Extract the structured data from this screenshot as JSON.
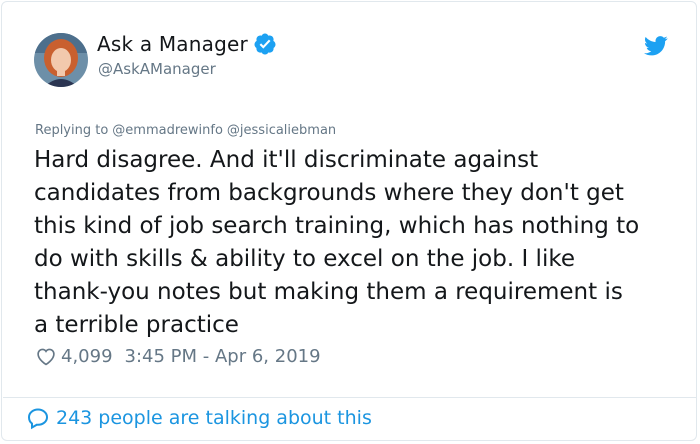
{
  "user": {
    "display_name": "Ask a Manager",
    "handle": "@AskAManager",
    "verified_icon": "verified-badge-icon",
    "avatar": "profile-photo"
  },
  "brand_icon": "twitter-bird-icon",
  "reply": {
    "prefix": "Replying to",
    "mentions": [
      "@emmadrewinfo",
      "@jessicaliebman"
    ]
  },
  "tweet": {
    "lines": [
      "Hard disagree. And it'll discriminate against",
      "candidates from backgrounds where they don't get",
      "this kind of job search training, which has nothing to",
      "do with skills & ability to excel on the job. I like",
      "thank-you notes but making them a requirement is",
      "a terrible practice"
    ]
  },
  "meta": {
    "like_count": "4,099",
    "timestamp": "3:45 PM - Apr 6, 2019"
  },
  "footer": {
    "talking_text": "243 people are talking about this"
  },
  "colors": {
    "accent": "#1da1f2",
    "link": "#1b95e0",
    "muted": "#657786",
    "text": "#14171a",
    "border": "#e1e8ed"
  }
}
